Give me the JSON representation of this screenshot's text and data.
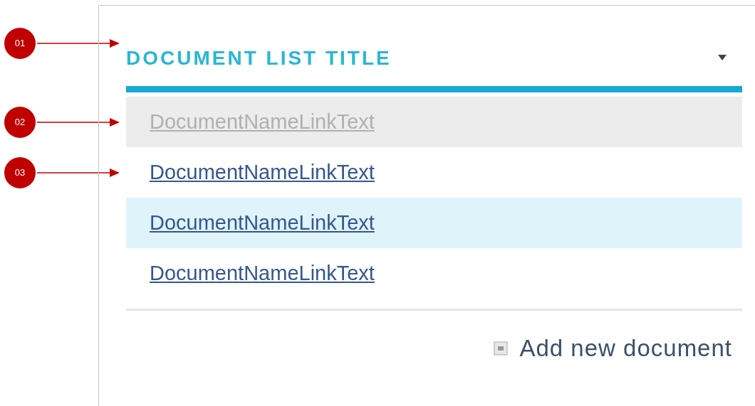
{
  "title": {
    "text": "DOCUMENT LIST TITLE",
    "callout": "01"
  },
  "items": [
    {
      "text": "DocumentNameLinkText",
      "disabled": true,
      "selected": false,
      "callout": "02"
    },
    {
      "text": "DocumentNameLinkText",
      "disabled": false,
      "selected": false,
      "callout": "03"
    },
    {
      "text": "DocumentNameLinkText",
      "disabled": false,
      "selected": true
    },
    {
      "text": "DocumentNameLinkText",
      "disabled": false,
      "selected": false
    }
  ],
  "add_link": {
    "text": "Add new document"
  }
}
